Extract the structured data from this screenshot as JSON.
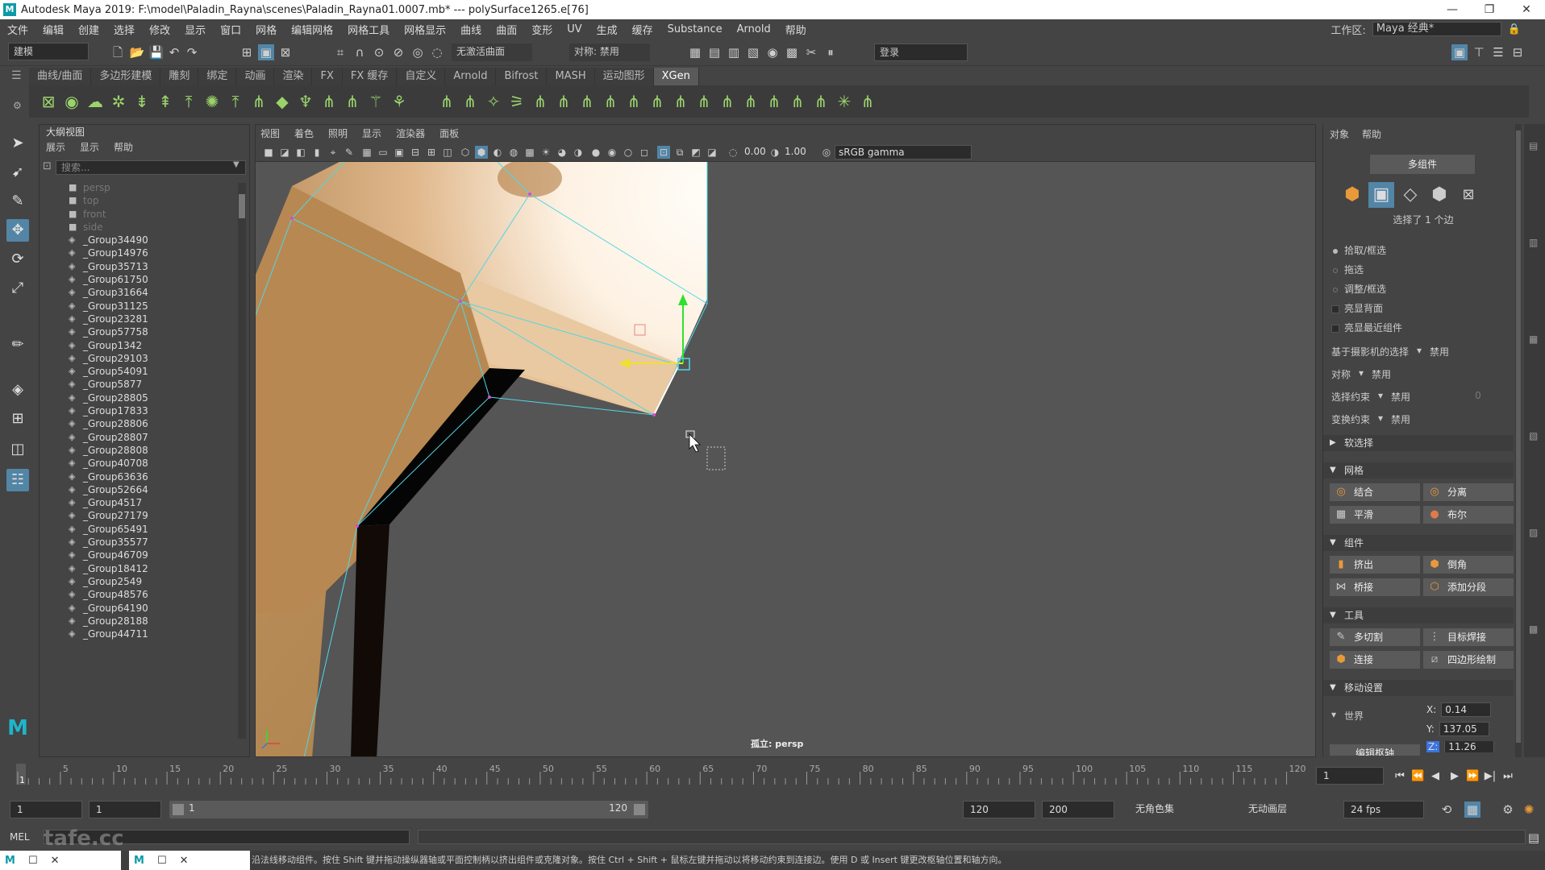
{
  "titlebar": {
    "title": "Autodesk Maya 2019: F:\\model\\Paladin_Rayna\\scenes\\Paladin_Rayna01.0007.mb*   ---   polySurface1265.e[76]",
    "logo": "M",
    "minimize": "—",
    "restore": "❐",
    "close": "✕"
  },
  "menubar": {
    "items": [
      "文件",
      "编辑",
      "创建",
      "选择",
      "修改",
      "显示",
      "窗口",
      "网格",
      "编辑网格",
      "网格工具",
      "网格显示",
      "曲线",
      "曲面",
      "变形",
      "UV",
      "生成",
      "缓存",
      "Substance",
      "Arnold",
      "帮助"
    ],
    "workspace_label": "工作区:",
    "workspace_value": "Maya 经典*"
  },
  "statusline": {
    "mode": "建模",
    "live_surface": "无激活曲面",
    "symmetry": "对称: 禁用",
    "login": "登录"
  },
  "shelf": {
    "tabs": [
      "曲线/曲面",
      "多边形建模",
      "雕刻",
      "绑定",
      "动画",
      "渲染",
      "FX",
      "FX 缓存",
      "自定义",
      "Arnold",
      "Bifrost",
      "MASH",
      "运动图形",
      "XGen"
    ],
    "active_tab": "XGen"
  },
  "outliner": {
    "title": "大纲视图",
    "menu": [
      "展示",
      "显示",
      "帮助"
    ],
    "search_placeholder": "搜索...",
    "items": [
      {
        "label": "persp",
        "type": "camera"
      },
      {
        "label": "top",
        "type": "camera"
      },
      {
        "label": "front",
        "type": "camera"
      },
      {
        "label": "side",
        "type": "camera"
      },
      {
        "label": "_Group34490",
        "type": "group"
      },
      {
        "label": "_Group14976",
        "type": "group"
      },
      {
        "label": "_Group35713",
        "type": "group"
      },
      {
        "label": "_Group61750",
        "type": "group"
      },
      {
        "label": "_Group31664",
        "type": "group"
      },
      {
        "label": "_Group31125",
        "type": "group"
      },
      {
        "label": "_Group23281",
        "type": "group"
      },
      {
        "label": "_Group57758",
        "type": "group"
      },
      {
        "label": "_Group1342",
        "type": "group"
      },
      {
        "label": "_Group29103",
        "type": "group"
      },
      {
        "label": "_Group54091",
        "type": "group"
      },
      {
        "label": "_Group5877",
        "type": "group"
      },
      {
        "label": "_Group28805",
        "type": "group"
      },
      {
        "label": "_Group17833",
        "type": "group"
      },
      {
        "label": "_Group28806",
        "type": "group"
      },
      {
        "label": "_Group28807",
        "type": "group"
      },
      {
        "label": "_Group28808",
        "type": "group"
      },
      {
        "label": "_Group40708",
        "type": "group"
      },
      {
        "label": "_Group63636",
        "type": "group"
      },
      {
        "label": "_Group52664",
        "type": "group"
      },
      {
        "label": "_Group4517",
        "type": "group"
      },
      {
        "label": "_Group27179",
        "type": "group"
      },
      {
        "label": "_Group65491",
        "type": "group"
      },
      {
        "label": "_Group35577",
        "type": "group"
      },
      {
        "label": "_Group46709",
        "type": "group"
      },
      {
        "label": "_Group18412",
        "type": "group"
      },
      {
        "label": "_Group2549",
        "type": "group"
      },
      {
        "label": "_Group48576",
        "type": "group"
      },
      {
        "label": "_Group64190",
        "type": "group"
      },
      {
        "label": "_Group28188",
        "type": "group"
      },
      {
        "label": "_Group44711",
        "type": "group"
      }
    ]
  },
  "viewport": {
    "menu": [
      "视图",
      "着色",
      "照明",
      "显示",
      "渲染器",
      "面板"
    ],
    "exposure": "0.00",
    "gamma": "1.00",
    "color_space": "sRGB gamma",
    "camera_label": "孤立: persp"
  },
  "toolkit": {
    "menu": [
      "对象",
      "帮助"
    ],
    "multi_component": "多组件",
    "selection_info": "选择了 1 个边",
    "pick_marquee": "拾取/框选",
    "drag": "拖选",
    "tweak_marquee": "调整/框选",
    "backface_highlight": "亮显背面",
    "nearest_highlight": "亮显最近组件",
    "camera_based_label": "基于摄影机的选择",
    "camera_based_value": "禁用",
    "symmetry_label": "对称",
    "symmetry_value": "禁用",
    "select_constraint_label": "选择约束",
    "select_constraint_value": "禁用",
    "select_constraint_num": "0",
    "transform_constraint_label": "变换约束",
    "transform_constraint_value": "禁用",
    "soft_select": "软选择",
    "mesh_section": "网格",
    "combine": "结合",
    "separate": "分离",
    "smooth": "平滑",
    "boolean": "布尔",
    "components_section": "组件",
    "extrude": "挤出",
    "bevel": "倒角",
    "bridge": "桥接",
    "add_divisions": "添加分段",
    "tools_section": "工具",
    "multi_cut": "多切割",
    "target_weld": "目标焊接",
    "connect": "连接",
    "quad_draw": "四边形绘制",
    "move_settings": "移动设置",
    "space": "世界",
    "x_label": "X:",
    "x_value": "0.14",
    "y_label": "Y:",
    "y_value": "137.05",
    "z_label": "Z:",
    "z_value": "11.26",
    "edit_pivot": "编辑枢轴"
  },
  "timeslider": {
    "ticks": [
      "1",
      "5",
      "10",
      "15",
      "20",
      "25",
      "30",
      "35",
      "40",
      "45",
      "50",
      "55",
      "60",
      "65",
      "70",
      "75",
      "80",
      "85",
      "90",
      "95",
      "100",
      "105",
      "110",
      "115",
      "120"
    ],
    "current_frame": "1"
  },
  "range": {
    "start": "1",
    "playback_start": "1",
    "slider_start": "1",
    "slider_end": "120",
    "playback_end": "120",
    "end": "200",
    "character_set": "无角色集",
    "anim_layer": "无动画层",
    "fps": "24 fps"
  },
  "cmdline": {
    "lang": "MEL"
  },
  "helpline": {
    "text": "沿法线移动组件。按住 Shift 键并拖动操纵器轴或平面控制柄以挤出组件或克隆对象。按住 Ctrl + Shift + 鼠标左键并拖动以将移动约束到连接边。使用 D 或 Insert 键更改枢轴位置和轴方向。"
  },
  "watermark": "tafe.cc",
  "colors": {
    "accent": "#5285a6",
    "mesh_light": "#fff6e8",
    "mesh_mid": "#c49a6a",
    "mesh_dark": "#a07840",
    "wire": "#4fd7e6",
    "viewport_bg": "#555555"
  }
}
